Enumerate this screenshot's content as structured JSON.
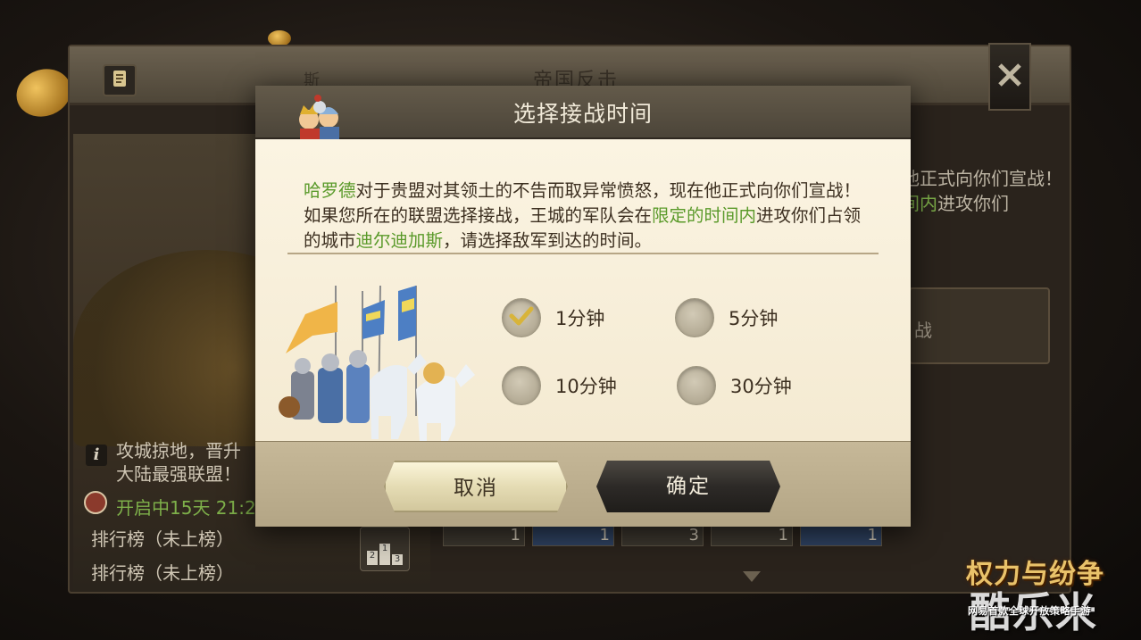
{
  "background": {
    "window_title": "帝国反击",
    "tab_label": "斯",
    "info_text": "攻城掠地，晋升\n大陆最强联盟！",
    "timer_text": "开启中15天 21:2",
    "rank_rows": [
      "排行榜（未上榜）",
      "排行榜（未上榜）"
    ],
    "podium": [
      "2",
      "1",
      "3"
    ],
    "right_text_before": "他正式向你们宣战！",
    "right_text_highlight": "间内",
    "right_text_after": "进攻你们",
    "right_button_label": "战",
    "reward_counts": [
      "1",
      "1",
      "3",
      "1",
      "1"
    ]
  },
  "dialog": {
    "title": "选择接战时间",
    "text_parts": [
      {
        "text": "哈罗德",
        "highlight": true
      },
      {
        "text": "对于贵盟对其领土的不告而取异常愤怒，现在他正式向你们宣战！如果您所在的联盟选择接战，王城的军队会在",
        "highlight": false
      },
      {
        "text": "限定的时间内",
        "highlight": true
      },
      {
        "text": "进攻你们占领的城市",
        "highlight": false
      },
      {
        "text": "迪尔迪加斯",
        "highlight": true
      },
      {
        "text": "，请选择敌军到达的时间。",
        "highlight": false
      }
    ],
    "options": [
      {
        "label": "1分钟",
        "selected": true
      },
      {
        "label": "5分钟",
        "selected": false
      },
      {
        "label": "10分钟",
        "selected": false
      },
      {
        "label": "30分钟",
        "selected": false
      }
    ],
    "cancel_label": "取消",
    "confirm_label": "确定"
  },
  "watermark": {
    "game_logo": "权力与纷争",
    "site": "酷乐米",
    "tagline": "网易首款全球开放策略手游"
  },
  "colors": {
    "highlight": "#5a9a2a",
    "dialog_bg": "#f8f0da",
    "header_bg": "#5a5244",
    "footer_bg": "#bfb190"
  },
  "icons": [
    "scroll-icon",
    "close-icon",
    "info-icon",
    "clock-icon",
    "checkmark-icon",
    "heroes-icon",
    "army-illustration"
  ]
}
